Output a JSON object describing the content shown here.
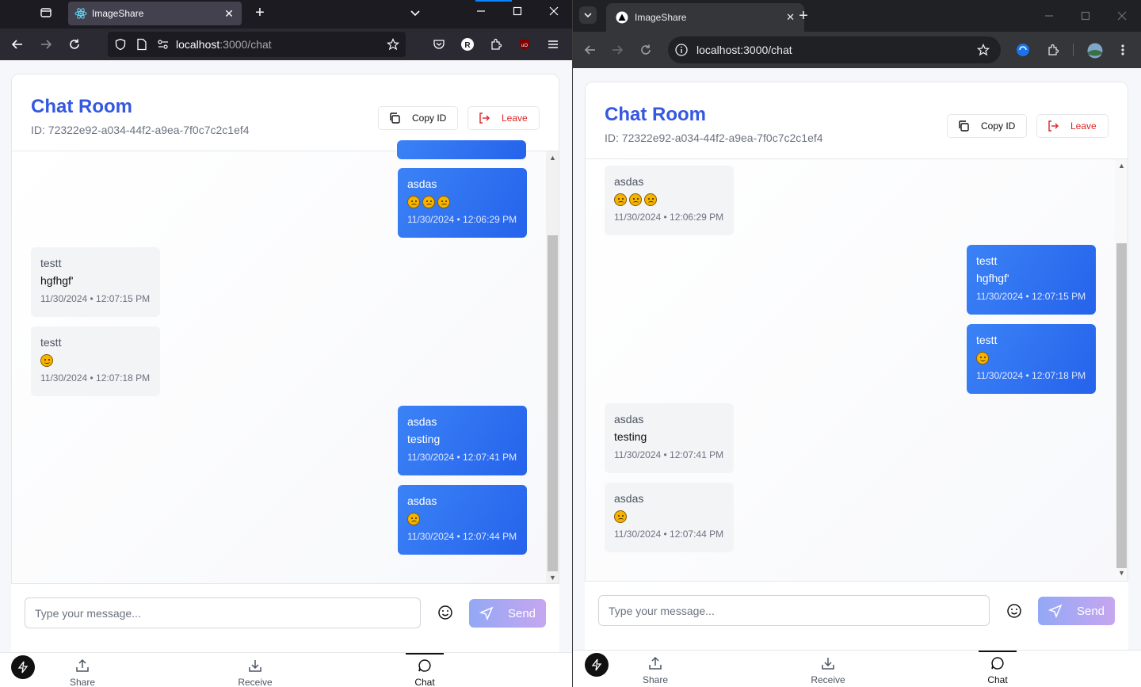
{
  "left_browser": {
    "tab_title": "ImageShare",
    "url_host": "localhost",
    "url_rest": ":3000/chat"
  },
  "right_browser": {
    "tab_title": "ImageShare",
    "url": "localhost:3000/chat"
  },
  "room": {
    "title": "Chat Room",
    "id_label": "ID: 72322e92-a034-44f2-a9ea-7f0c7c2c1ef4",
    "copy_label": "Copy ID",
    "leave_label": "Leave"
  },
  "left_messages": [
    {
      "sender": "asdas",
      "text": "",
      "emoji": [
        "frown",
        "frown",
        "frown"
      ],
      "time": "11/30/2024 • 12:06:29 PM",
      "mine": true
    },
    {
      "sender": "testt",
      "text": "hgfhgf'",
      "emoji": [],
      "time": "11/30/2024 • 12:07:15 PM",
      "mine": false
    },
    {
      "sender": "testt",
      "text": "",
      "emoji": [
        "wink"
      ],
      "time": "11/30/2024 • 12:07:18 PM",
      "mine": false
    },
    {
      "sender": "asdas",
      "text": "testing",
      "emoji": [],
      "time": "11/30/2024 • 12:07:41 PM",
      "mine": true
    },
    {
      "sender": "asdas",
      "text": "",
      "emoji": [
        "frown"
      ],
      "time": "11/30/2024 • 12:07:44 PM",
      "mine": true
    }
  ],
  "right_messages": [
    {
      "sender": "asdas",
      "text": "",
      "emoji": [
        "frown",
        "frown",
        "frown"
      ],
      "time": "11/30/2024 • 12:06:29 PM",
      "mine": false
    },
    {
      "sender": "testt",
      "text": "hgfhgf'",
      "emoji": [],
      "time": "11/30/2024 • 12:07:15 PM",
      "mine": true
    },
    {
      "sender": "testt",
      "text": "",
      "emoji": [
        "wink"
      ],
      "time": "11/30/2024 • 12:07:18 PM",
      "mine": true
    },
    {
      "sender": "asdas",
      "text": "testing",
      "emoji": [],
      "time": "11/30/2024 • 12:07:41 PM",
      "mine": false
    },
    {
      "sender": "asdas",
      "text": "",
      "emoji": [
        "frown"
      ],
      "time": "11/30/2024 • 12:07:44 PM",
      "mine": false
    }
  ],
  "composer": {
    "placeholder": "Type your message...",
    "send_label": "Send"
  },
  "nav": {
    "share": "Share",
    "receive": "Receive",
    "chat": "Chat"
  },
  "colors": {
    "accent": "#3558e0",
    "bubble_mine": "#2563eb",
    "leave": "#dc2626"
  }
}
